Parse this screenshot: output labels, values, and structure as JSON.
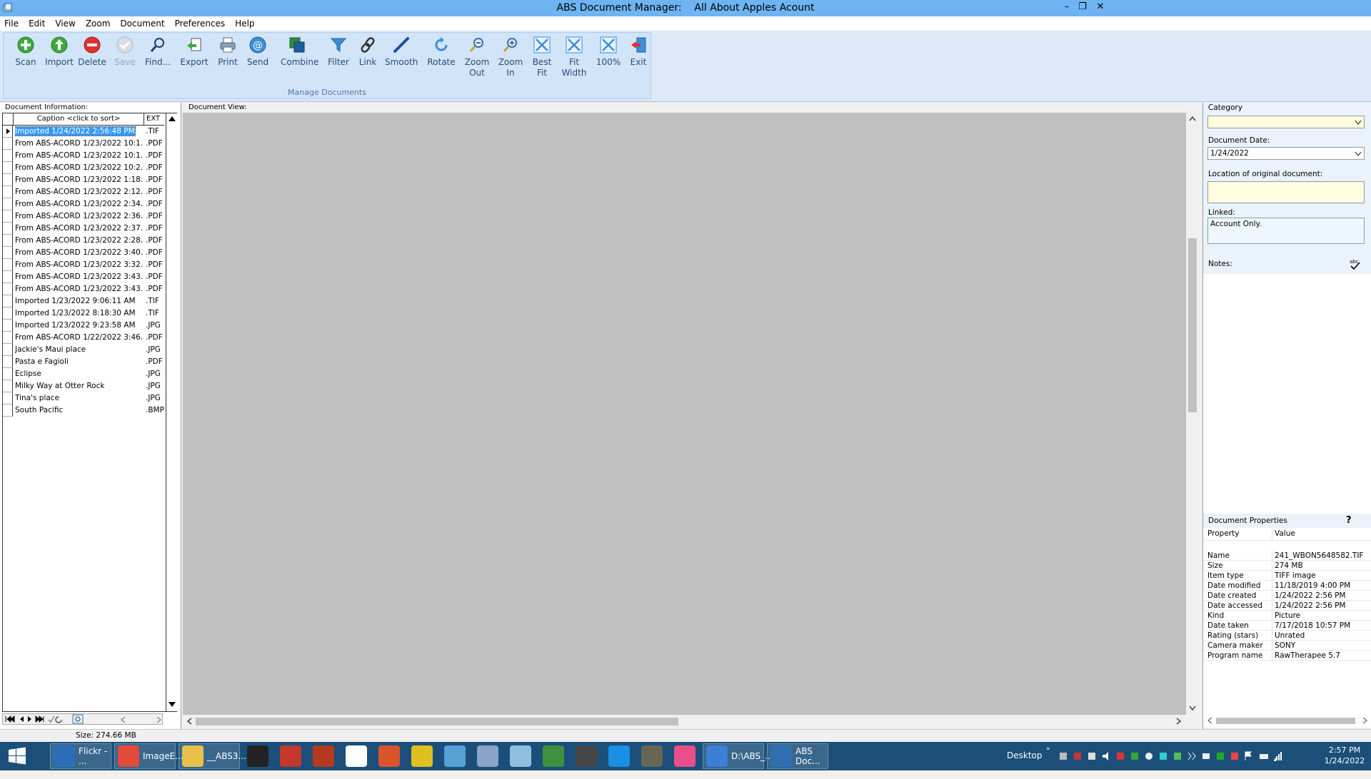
{
  "window": {
    "title": "ABS Document Manager:    All About Apples Acount"
  },
  "menu": [
    "File",
    "Edit",
    "View",
    "Zoom",
    "Document",
    "Preferences",
    "Help"
  ],
  "ribbon": {
    "group_label": "Manage Documents",
    "buttons": [
      {
        "label": "Scan",
        "icon": "scan-icon",
        "enabled": true
      },
      {
        "label": "Import",
        "icon": "import-icon",
        "enabled": true
      },
      {
        "label": "Delete",
        "icon": "delete-icon",
        "enabled": true
      },
      {
        "label": "Save",
        "icon": "save-icon",
        "enabled": false
      },
      {
        "label": "Find...",
        "icon": "find-icon",
        "enabled": true
      },
      {
        "label": "Export",
        "icon": "export-icon",
        "enabled": true
      },
      {
        "label": "Print",
        "icon": "print-icon",
        "enabled": true
      },
      {
        "label": "Send",
        "icon": "send-icon",
        "enabled": true
      },
      {
        "label": "Combine",
        "icon": "combine-icon",
        "enabled": true
      },
      {
        "label": "Filter",
        "icon": "filter-icon",
        "enabled": true
      },
      {
        "label": "Link",
        "icon": "link-icon",
        "enabled": true
      },
      {
        "label": "Smooth",
        "icon": "smooth-icon",
        "enabled": true
      },
      {
        "label": "Rotate",
        "icon": "rotate-icon",
        "enabled": true
      },
      {
        "label": "Zoom\nOut",
        "icon": "zoom-out-icon",
        "enabled": true
      },
      {
        "label": "Zoom\nIn",
        "icon": "zoom-in-icon",
        "enabled": true
      },
      {
        "label": "Best\nFit",
        "icon": "best-fit-icon",
        "enabled": true
      },
      {
        "label": "Fit\nWidth",
        "icon": "fit-width-icon",
        "enabled": true
      },
      {
        "label": "100%",
        "icon": "actual-size-icon",
        "enabled": true
      },
      {
        "label": "Exit",
        "icon": "exit-icon",
        "enabled": true
      }
    ]
  },
  "doc_info": {
    "header": "Document Information:",
    "col_caption": "Caption   <click to sort>",
    "col_ext": "EXT",
    "rows": [
      {
        "caption": "Imported 1/24/2022 2:56:48 PM",
        "ext": ".TIF"
      },
      {
        "caption": "From ABS-ACORD 1/23/2022 10:1...",
        "ext": ".PDF"
      },
      {
        "caption": "From ABS-ACORD 1/23/2022 10:1...",
        "ext": ".PDF"
      },
      {
        "caption": "From ABS-ACORD 1/23/2022 10:2...",
        "ext": ".PDF"
      },
      {
        "caption": "From ABS-ACORD 1/23/2022 1:18...",
        "ext": ".PDF"
      },
      {
        "caption": "From ABS-ACORD 1/23/2022 2:12...",
        "ext": ".PDF"
      },
      {
        "caption": "From ABS-ACORD 1/23/2022 2:34...",
        "ext": ".PDF"
      },
      {
        "caption": "From ABS-ACORD 1/23/2022 2:36...",
        "ext": ".PDF"
      },
      {
        "caption": "From ABS-ACORD 1/23/2022 2:37...",
        "ext": ".PDF"
      },
      {
        "caption": "From ABS-ACORD 1/23/2022 2:28...",
        "ext": ".PDF"
      },
      {
        "caption": "From ABS-ACORD 1/23/2022 3:40...",
        "ext": ".PDF"
      },
      {
        "caption": "From ABS-ACORD 1/23/2022 3:32...",
        "ext": ".PDF"
      },
      {
        "caption": "From ABS-ACORD 1/23/2022 3:43...",
        "ext": ".PDF"
      },
      {
        "caption": "From ABS-ACORD 1/23/2022 3:43...",
        "ext": ".PDF"
      },
      {
        "caption": "Imported 1/23/2022 9:06:11 AM",
        "ext": ".TIF"
      },
      {
        "caption": "Imported 1/23/2022 8:18:30 AM",
        "ext": ".TIF"
      },
      {
        "caption": "Imported 1/23/2022 9:23:58 AM",
        "ext": ".JPG"
      },
      {
        "caption": "From ABS-ACORD 1/22/2022 3:46...",
        "ext": ".PDF"
      },
      {
        "caption": "Jackie's Maui place",
        "ext": ".JPG"
      },
      {
        "caption": "Pasta e Fagioli",
        "ext": ".PDF"
      },
      {
        "caption": "Eclipse",
        "ext": ".JPG"
      },
      {
        "caption": "Milky Way at Otter Rock",
        "ext": ".JPG"
      },
      {
        "caption": "Tina's place",
        "ext": ".JPG"
      },
      {
        "caption": "South Pacific",
        "ext": ".BMP"
      }
    ]
  },
  "doc_view": {
    "header": "Document View:"
  },
  "right": {
    "category_label": "Category",
    "category_value": "",
    "date_label": "Document Date:",
    "date_value": "1/24/2022",
    "location_label": "Location of original document:",
    "location_value": "",
    "linked_label": "Linked:",
    "linked_value": "Account Only.",
    "notes_label": "Notes:",
    "props_label": "Document Properties",
    "props_help": "?",
    "col_property": "Property",
    "col_value": "Value",
    "properties": [
      {
        "p": "Name",
        "v": "241_WBON5648582.TIF"
      },
      {
        "p": "Size",
        "v": "274 MB"
      },
      {
        "p": "Item type",
        "v": "TIFF image"
      },
      {
        "p": "Date modified",
        "v": "11/18/2019 4:00 PM"
      },
      {
        "p": "Date created",
        "v": "1/24/2022 2:56 PM"
      },
      {
        "p": "Date accessed",
        "v": "1/24/2022 2:56 PM"
      },
      {
        "p": "Kind",
        "v": "Picture"
      },
      {
        "p": "Date taken",
        "v": "7/17/2018 10:57 PM"
      },
      {
        "p": "Rating (stars)",
        "v": "Unrated"
      },
      {
        "p": "Camera maker",
        "v": "SONY"
      },
      {
        "p": "Program name",
        "v": "RawTherapee 5.7"
      }
    ]
  },
  "status": {
    "size": "Size: 274.66 MB"
  },
  "taskbar": {
    "items": [
      {
        "label": "Flickr - ...",
        "color": "#2c6fb7"
      },
      {
        "label": "ImageE...",
        "color": "#e24b3b"
      },
      {
        "label": "__ABS3...",
        "color": "#e8c14a"
      },
      {
        "label": "",
        "color": "#222222"
      },
      {
        "label": "",
        "color": "#c0392b"
      },
      {
        "label": "",
        "color": "#b33a1e"
      },
      {
        "label": "",
        "color": "#ffffff"
      },
      {
        "label": "",
        "color": "#d9542b"
      },
      {
        "label": "",
        "color": "#e0c020"
      },
      {
        "label": "",
        "color": "#56a0d3"
      },
      {
        "label": "",
        "color": "#8aa4c8"
      },
      {
        "label": "",
        "color": "#8fbfe0"
      },
      {
        "label": "",
        "color": "#3f8f3f"
      },
      {
        "label": "",
        "color": "#444444"
      },
      {
        "label": "",
        "color": "#1a8fe3"
      },
      {
        "label": "",
        "color": "#666655"
      },
      {
        "label": "",
        "color": "#e94d8a"
      },
      {
        "label": "D:\\ABS_...",
        "color": "#3b7fd4"
      },
      {
        "label": "ABS Doc...",
        "color": "#2f6fb2"
      }
    ],
    "desktop": "Desktop",
    "time": "2:57 PM",
    "date": "1/24/2022"
  }
}
